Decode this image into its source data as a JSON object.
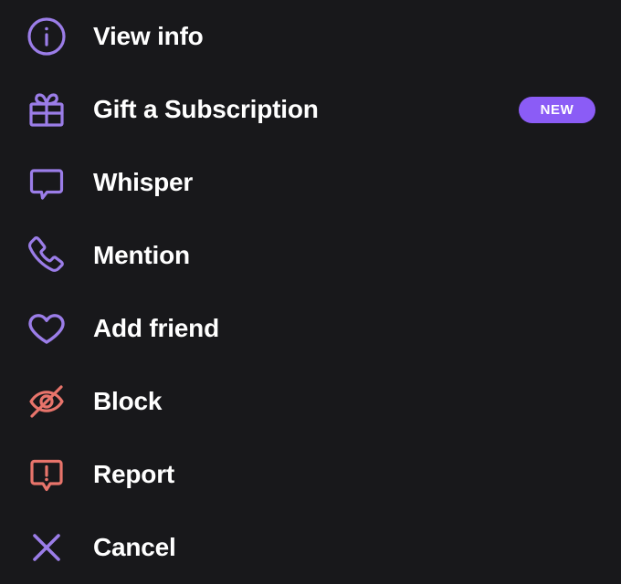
{
  "menu": {
    "background_color": "#18181b",
    "accent_color": "#9b7de8",
    "danger_color": "#e8746b",
    "badge_color": "#8b5cf6",
    "label_color": "#ffffff",
    "items": [
      {
        "id": "view-info",
        "label": "View info",
        "icon": "info-circle-icon",
        "icon_color": "#9b7de8",
        "badge": null
      },
      {
        "id": "gift-subscription",
        "label": "Gift a Subscription",
        "icon": "gift-icon",
        "icon_color": "#9b7de8",
        "badge": "NEW"
      },
      {
        "id": "whisper",
        "label": "Whisper",
        "icon": "speech-bubble-icon",
        "icon_color": "#9b7de8",
        "badge": null
      },
      {
        "id": "mention",
        "label": "Mention",
        "icon": "phone-icon",
        "icon_color": "#9b7de8",
        "badge": null
      },
      {
        "id": "add-friend",
        "label": "Add friend",
        "icon": "heart-icon",
        "icon_color": "#9b7de8",
        "badge": null
      },
      {
        "id": "block",
        "label": "Block",
        "icon": "eye-off-icon",
        "icon_color": "#e8746b",
        "badge": null
      },
      {
        "id": "report",
        "label": "Report",
        "icon": "report-bubble-icon",
        "icon_color": "#e8746b",
        "badge": null
      },
      {
        "id": "cancel",
        "label": "Cancel",
        "icon": "close-x-icon",
        "icon_color": "#9b7de8",
        "badge": null
      }
    ]
  }
}
